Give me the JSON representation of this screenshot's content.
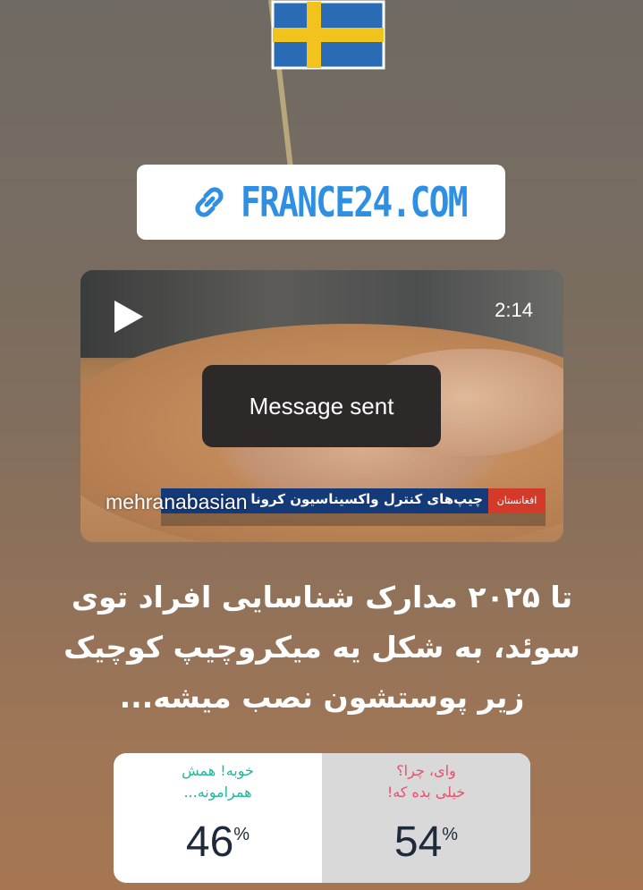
{
  "link_sticker": {
    "text": "FRANCE24.COM",
    "icon": "link-icon"
  },
  "flag": {
    "country": "Sweden",
    "colors": {
      "blue": "#2a6bb5",
      "yellow": "#f2c21d"
    }
  },
  "video": {
    "duration": "2:14",
    "watermark": "mehranabasian",
    "news_headline": "چیپ‌های کنترل واکسیناسیون کرونا",
    "news_tag": "افغانستان",
    "play_icon": "play-icon"
  },
  "toast": {
    "text": "Message sent"
  },
  "caption": {
    "lines": [
      "تا ۲۰۲۵ مدارک شناسایی افراد توی",
      "سوئد، به شکل یه میکروچیپ کوچیک",
      "زیر پوستشون نصب میشه..."
    ]
  },
  "poll": {
    "options": [
      {
        "label_line1": "خوبه! همش",
        "label_line2": "همرامونه...",
        "percent": "46",
        "color": "#1eb89a"
      },
      {
        "label_line1": "وای، چرا؟",
        "label_line2": "خیلی بده که!",
        "percent": "54",
        "color": "#ef4d6a"
      }
    ],
    "percent_sign": "%"
  }
}
